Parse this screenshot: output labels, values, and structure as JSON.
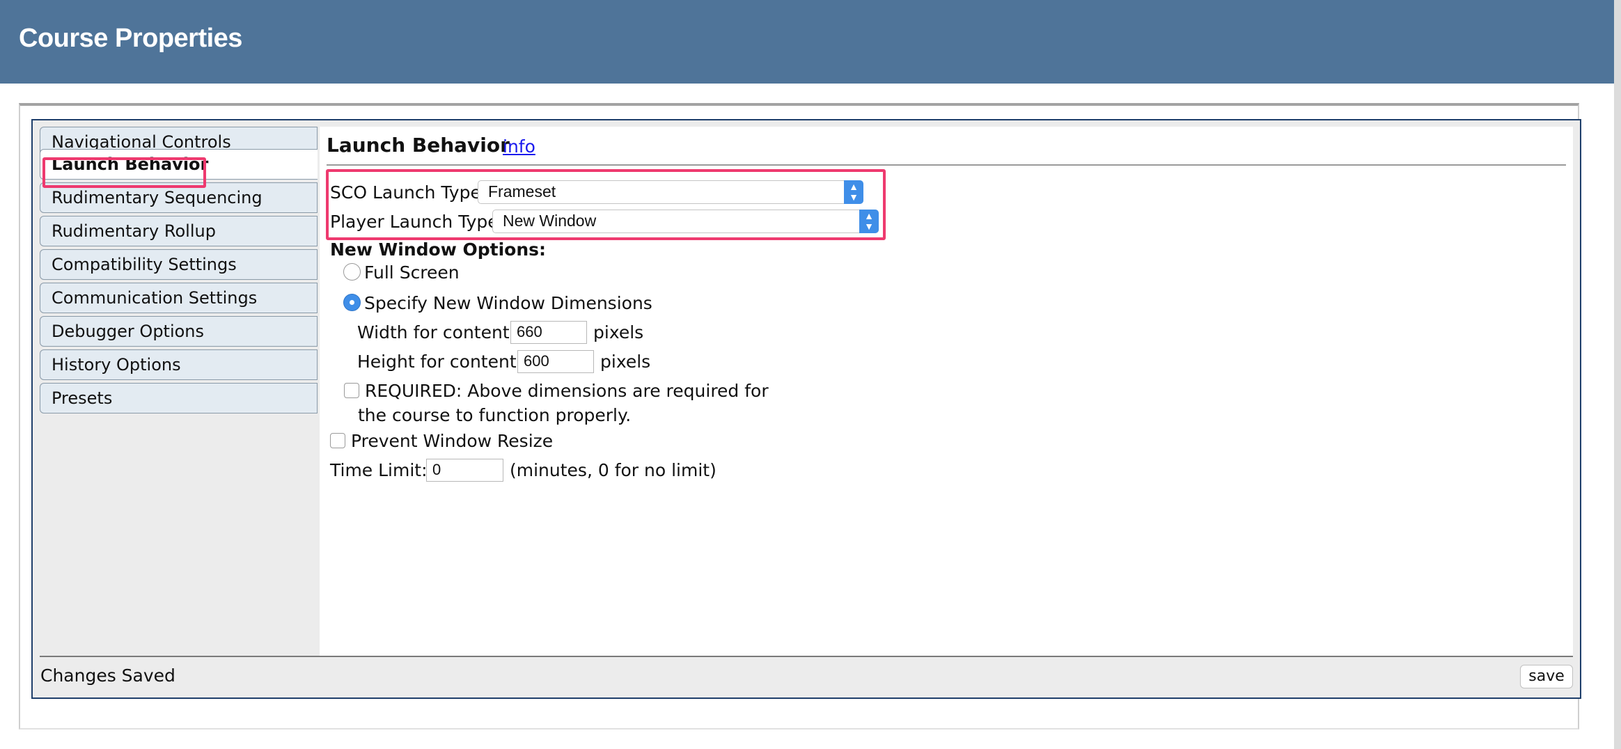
{
  "header": {
    "title": "Course Properties"
  },
  "sidebar": {
    "items": [
      {
        "label": "Navigational Controls"
      },
      {
        "label": "Launch Behavior"
      },
      {
        "label": "Rudimentary Sequencing"
      },
      {
        "label": "Rudimentary Rollup"
      },
      {
        "label": "Compatibility Settings"
      },
      {
        "label": "Communication Settings"
      },
      {
        "label": "Debugger Options"
      },
      {
        "label": "History Options"
      },
      {
        "label": "Presets"
      }
    ],
    "active_index": 1
  },
  "main": {
    "section_title": "Launch Behavior",
    "info_link": "info",
    "sco_launch_type": {
      "label": "SCO Launch Type",
      "value": "Frameset"
    },
    "player_launch_type": {
      "label": "Player Launch Type",
      "value": "New Window"
    },
    "new_window_options": {
      "heading": "New Window Options:",
      "full_screen_label": "Full Screen",
      "specify_label": "Specify New Window Dimensions",
      "width_label": "Width for content:",
      "width_value": "660",
      "height_label": "Height for content:",
      "height_value": "600",
      "pixels_unit": "pixels",
      "required_line1": "REQUIRED: Above dimensions are required for",
      "required_line2": "the course to function properly."
    },
    "prevent_resize_label": "Prevent Window Resize",
    "time_limit": {
      "label": "Time Limit:",
      "value": "0",
      "hint": "(minutes, 0 for no limit)"
    }
  },
  "footer": {
    "status": "Changes Saved",
    "save_label": "save"
  },
  "colors": {
    "header_bg": "#4f7499",
    "highlight": "#ee3a6f",
    "accent": "#3f8ee8"
  }
}
